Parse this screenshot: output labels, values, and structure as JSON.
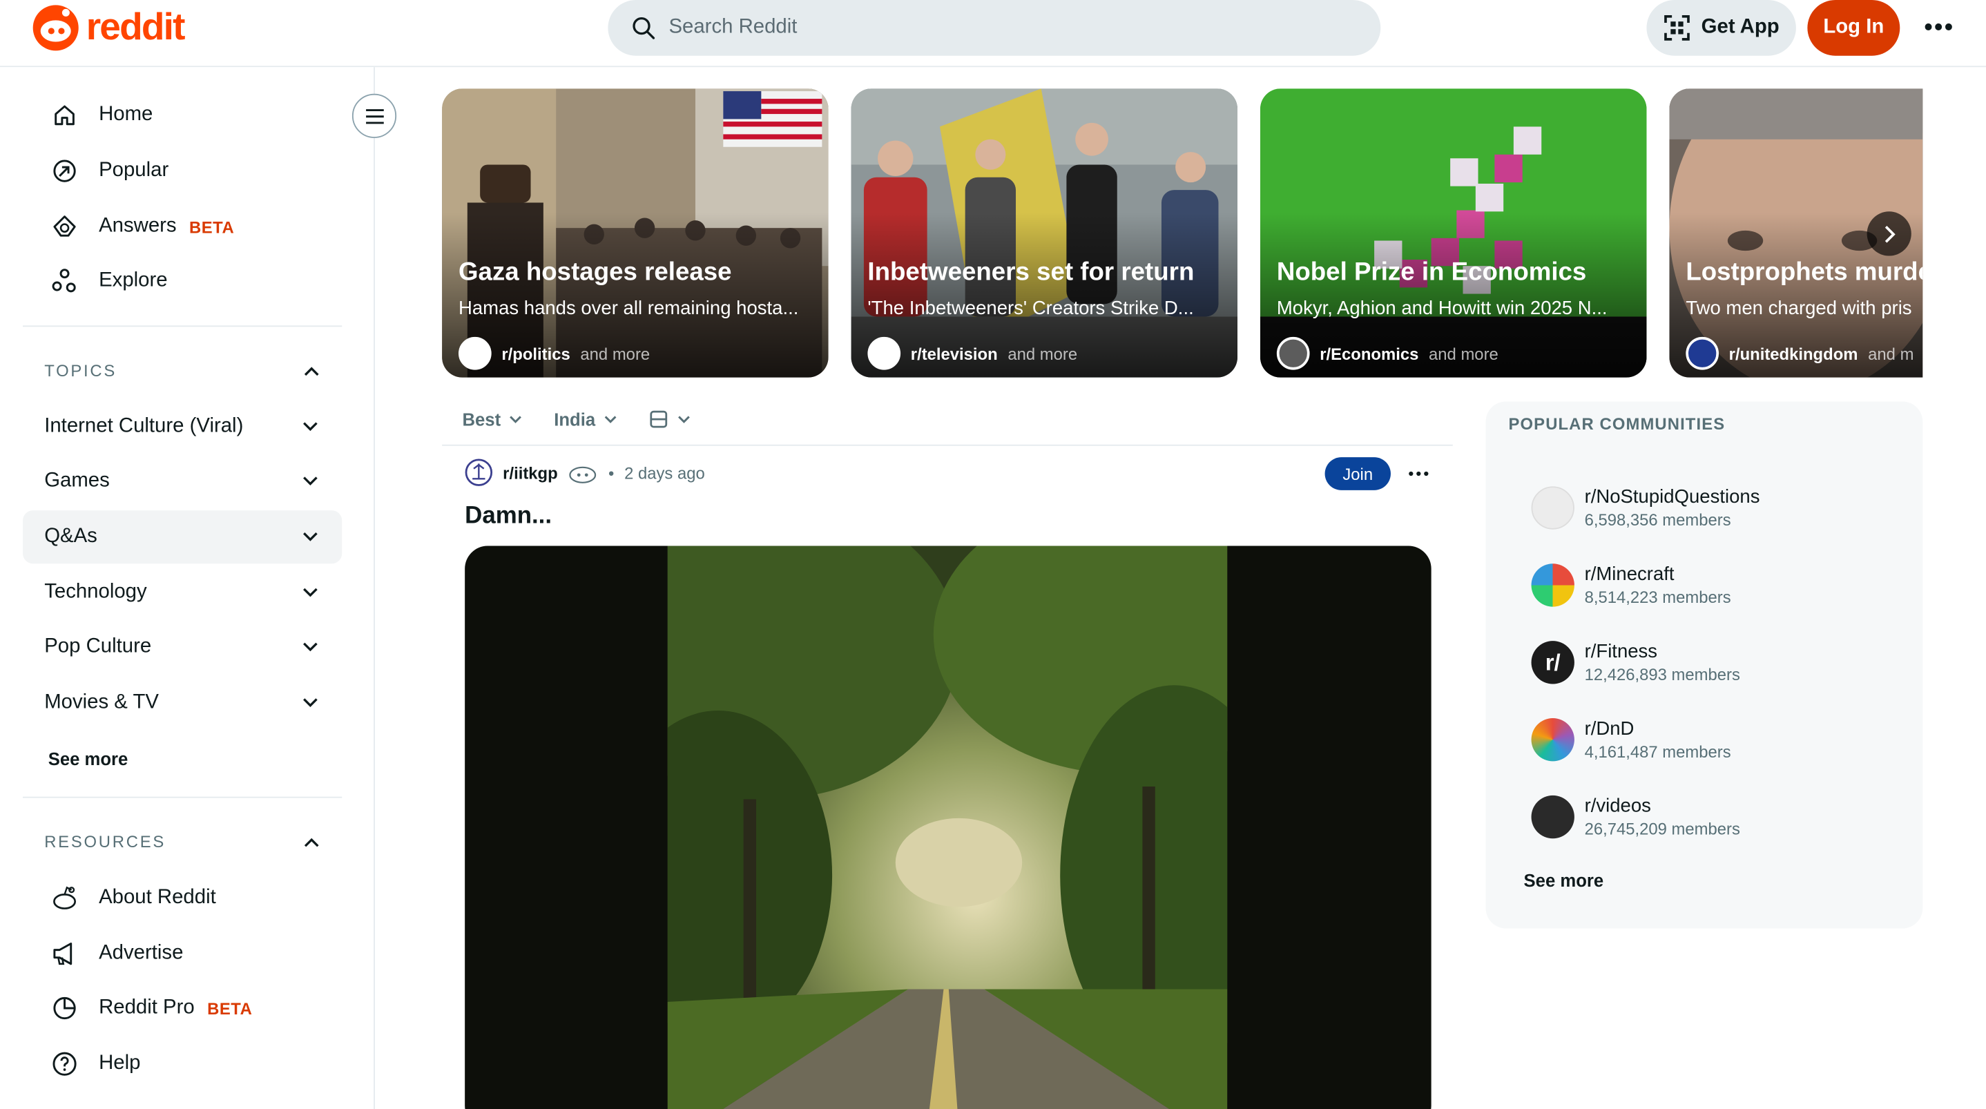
{
  "header": {
    "brand": "reddit",
    "search_placeholder": "Search Reddit",
    "get_app_label": "Get App",
    "login_label": "Log In",
    "more_label": "•••"
  },
  "sidebar": {
    "nav": [
      {
        "label": "Home",
        "icon": "home-icon"
      },
      {
        "label": "Popular",
        "icon": "popular-icon"
      },
      {
        "label": "Answers",
        "icon": "answers-icon",
        "badge": "BETA"
      },
      {
        "label": "Explore",
        "icon": "explore-icon"
      }
    ],
    "topics_heading": "TOPICS",
    "topics": [
      "Internet Culture (Viral)",
      "Games",
      "Q&As",
      "Technology",
      "Pop Culture",
      "Movies & TV"
    ],
    "topics_see_more": "See more",
    "resources_heading": "RESOURCES",
    "resources": [
      {
        "label": "About Reddit",
        "icon": "reddit-alien-icon"
      },
      {
        "label": "Advertise",
        "icon": "megaphone-icon"
      },
      {
        "label": "Reddit Pro",
        "icon": "pro-icon",
        "badge": "BETA"
      },
      {
        "label": "Help",
        "icon": "help-icon"
      }
    ]
  },
  "carousel": [
    {
      "title": "Gaza hostages release",
      "subtitle": "Hamas hands over all remaining hosta...",
      "subreddit": "r/politics",
      "more": "and more"
    },
    {
      "title": "Inbetweeners set for return",
      "subtitle": "'The Inbetweeners' Creators Strike D...",
      "subreddit": "r/television",
      "more": "and more"
    },
    {
      "title": "Nobel Prize in Economics",
      "subtitle": "Mokyr, Aghion and Howitt win 2025 N...",
      "subreddit": "r/Economics",
      "more": "and more"
    },
    {
      "title": "Lostprophets murde",
      "subtitle": "Two men charged with pris",
      "subreddit": "r/unitedkingdom",
      "more": "and m"
    }
  ],
  "feed": {
    "sort": "Best",
    "region": "India",
    "post": {
      "subreddit": "r/iitkgp",
      "time": "2 days ago",
      "join_label": "Join",
      "title": "Damn..."
    }
  },
  "popular": {
    "heading": "POPULAR COMMUNITIES",
    "communities": [
      {
        "name": "r/NoStupidQuestions",
        "members": "6,598,356 members"
      },
      {
        "name": "r/Minecraft",
        "members": "8,514,223 members"
      },
      {
        "name": "r/Fitness",
        "members": "12,426,893 members"
      },
      {
        "name": "r/DnD",
        "members": "4,161,487 members"
      },
      {
        "name": "r/videos",
        "members": "26,745,209 members"
      }
    ],
    "see_more": "See more"
  },
  "colors": {
    "brand": "#ff4500",
    "login_bg": "#d93a00",
    "join_bg": "#0a449b",
    "beta": "#d93a00"
  }
}
